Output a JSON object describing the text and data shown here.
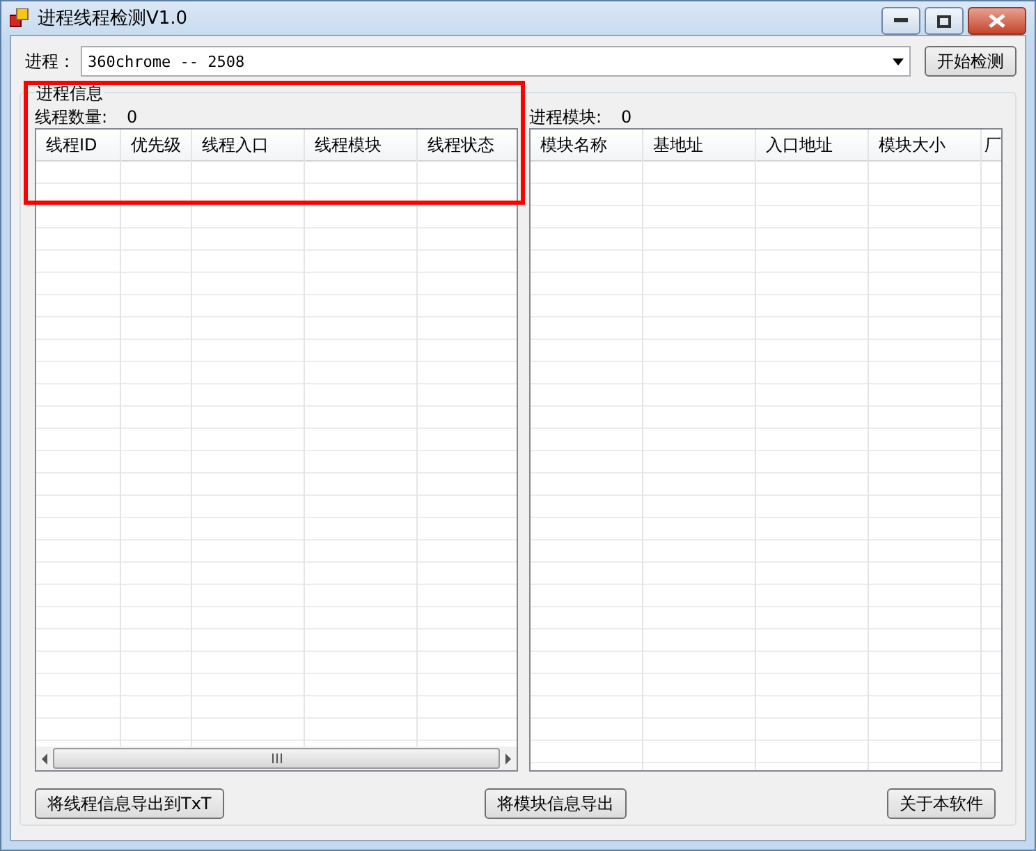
{
  "window": {
    "title": "进程线程检测V1.0"
  },
  "process": {
    "label": "进程：",
    "value": "360chrome -- 2508"
  },
  "start_button": "开始检测",
  "group": {
    "title": "进程信息"
  },
  "threads": {
    "count_label": "线程数量:",
    "count": "0",
    "columns": [
      "线程ID",
      "优先级",
      "线程入口",
      "线程模块",
      "线程状态"
    ]
  },
  "modules": {
    "count_label": "进程模块:",
    "count": "0",
    "columns": [
      "模块名称",
      "基地址",
      "入口地址",
      "模块大小",
      "厂"
    ]
  },
  "buttons": [
    "将线程信息导出到TxT",
    "将模块信息导出",
    "关于本软件"
  ],
  "highlight_frame": true
}
